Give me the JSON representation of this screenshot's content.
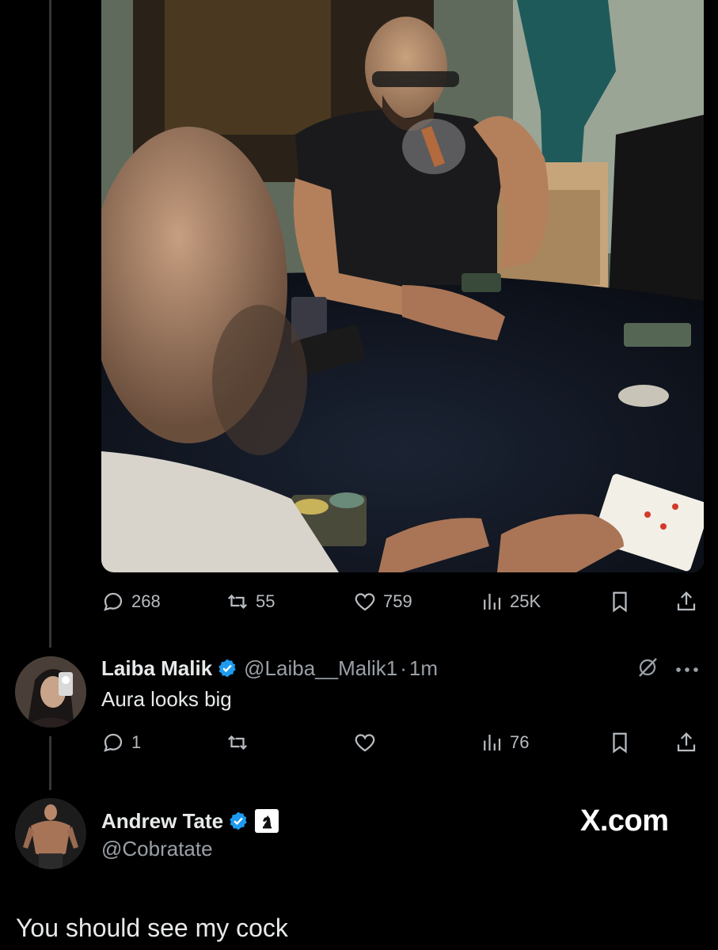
{
  "post_stats": {
    "replies": "268",
    "reposts": "55",
    "likes": "759",
    "views": "25K"
  },
  "reply": {
    "display_name": "Laiba Malik",
    "handle": "@Laiba__Malik1",
    "separator": "·",
    "time": "1m",
    "text": "Aura looks big",
    "stats": {
      "replies": "1",
      "reposts": "",
      "likes": "",
      "views": "76"
    }
  },
  "next_post": {
    "display_name": "Andrew Tate",
    "handle": "@Cobratate",
    "text": "You should see my cock"
  },
  "watermark": "X.com",
  "colors": {
    "background": "#000000",
    "text": "#e7e9ea",
    "muted": "#9aa0a6",
    "verified": "#1d9bf0"
  },
  "icons": [
    "reply-icon",
    "repost-icon",
    "like-icon",
    "views-icon",
    "bookmark-icon",
    "share-icon",
    "verified-badge-icon",
    "grok-slash-icon",
    "more-icon",
    "knight-chess-icon"
  ]
}
